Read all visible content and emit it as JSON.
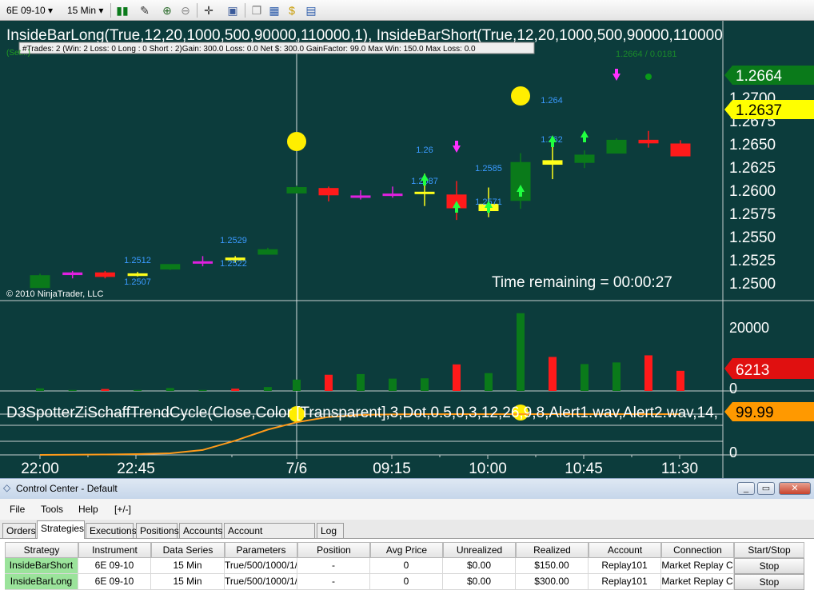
{
  "toolbar": {
    "instrument": "6E 09-10",
    "timeframe": "15 Min"
  },
  "chart": {
    "strategy_title": "InsideBarLong(True,12,20,1000,500,90000,110000,1), InsideBarShort(True,12,20,1000,500,90000,110000",
    "stats": "#Trades: 2 (Win: 2 Loss: 0 Long : 0 Short : 2)Gain: 300.0 Loss: 0.0 Net $: 300.0 GainFactor: 99.0 Max Win: 150.0 Max Loss: 0.0",
    "subtitle": "(Set...)",
    "copyright": "© 2010 NinjaTrader, LLC",
    "time_remaining": "Time remaining = 00:00:27",
    "crosshair_readout": "1.2664 / 0.0181",
    "price_badge_green": "1.2664",
    "price_badge_yellow": "1.2637",
    "volume_badge": "6213",
    "indicator_title": "D3SpotterZiSchaffTrendCycle(Close,Color [Transparent],3,Dot,0.5,0,3,12,26,9,8,Alert1.wav,Alert2.wav,14,",
    "indicator_badge": "99.99",
    "bar_labels": [
      "1.2512",
      "1.2507",
      "1.2529",
      "1.2522",
      "1.26",
      "1.2587",
      "1.2585",
      "1.2571",
      "1.264",
      "1.262"
    ],
    "colors": {
      "background": "#0c3c3c",
      "up": "#0a7a1a",
      "down": "#ff1a1a",
      "doji": "#ffff1a",
      "neutral": "#e020e0",
      "badge_green": "#0a7a1a",
      "badge_yellow": "#ffff00",
      "badge_red": "#e01010",
      "badge_orange": "#ff9900",
      "cycle_line": "#ff9a1a"
    }
  },
  "chart_data": {
    "type": "candlestick",
    "y_ticks": [
      "1.2700",
      "1.2675",
      "1.2650",
      "1.2625",
      "1.2600",
      "1.2575",
      "1.2550",
      "1.2525",
      "1.2500"
    ],
    "volume_ticks": [
      "20000",
      "0"
    ],
    "indicator_ticks": [
      "0"
    ],
    "x_ticks": [
      "22:00",
      "22:45",
      "7/6",
      "09:15",
      "10:00",
      "10:45",
      "11:30"
    ],
    "candles": [
      {
        "o": 1.2495,
        "h": 1.251,
        "l": 1.2495,
        "c": 1.2508,
        "color": "up"
      },
      {
        "o": 1.2511,
        "h": 1.2513,
        "l": 1.2505,
        "c": 1.2509,
        "color": "neutral"
      },
      {
        "o": 1.2511,
        "h": 1.2513,
        "l": 1.2505,
        "c": 1.2507,
        "color": "down"
      },
      {
        "o": 1.251,
        "h": 1.2512,
        "l": 1.2507,
        "c": 1.2508,
        "color": "doji"
      },
      {
        "o": 1.2515,
        "h": 1.252,
        "l": 1.2514,
        "c": 1.252,
        "color": "up"
      },
      {
        "o": 1.2523,
        "h": 1.2529,
        "l": 1.2518,
        "c": 1.2522,
        "color": "neutral"
      },
      {
        "o": 1.2525,
        "h": 1.2529,
        "l": 1.2522,
        "c": 1.2527,
        "color": "doji"
      },
      {
        "o": 1.2531,
        "h": 1.2538,
        "l": 1.2531,
        "c": 1.2536,
        "color": "up"
      },
      {
        "o": 1.2597,
        "h": 1.2605,
        "l": 1.2597,
        "c": 1.2603,
        "color": "up"
      },
      {
        "o": 1.2602,
        "h": 1.2604,
        "l": 1.2588,
        "c": 1.2595,
        "color": "down"
      },
      {
        "o": 1.2594,
        "h": 1.26,
        "l": 1.259,
        "c": 1.2594,
        "color": "neutral"
      },
      {
        "o": 1.2596,
        "h": 1.2604,
        "l": 1.2592,
        "c": 1.2596,
        "color": "neutral"
      },
      {
        "o": 1.2598,
        "h": 1.2618,
        "l": 1.2583,
        "c": 1.2597,
        "color": "doji"
      },
      {
        "o": 1.2595,
        "h": 1.261,
        "l": 1.2568,
        "c": 1.2581,
        "color": "down"
      },
      {
        "o": 1.2585,
        "h": 1.2603,
        "l": 1.2571,
        "c": 1.2578,
        "color": "doji"
      },
      {
        "o": 1.2589,
        "h": 1.264,
        "l": 1.258,
        "c": 1.263,
        "color": "up"
      },
      {
        "o": 1.2632,
        "h": 1.2653,
        "l": 1.2612,
        "c": 1.2628,
        "color": "doji"
      },
      {
        "o": 1.263,
        "h": 1.2643,
        "l": 1.2624,
        "c": 1.2638,
        "color": "up"
      },
      {
        "o": 1.264,
        "h": 1.2656,
        "l": 1.264,
        "c": 1.2654,
        "color": "up"
      },
      {
        "o": 1.2654,
        "h": 1.2664,
        "l": 1.2646,
        "c": 1.2651,
        "color": "down"
      },
      {
        "o": 1.265,
        "h": 1.2654,
        "l": 1.2637,
        "c": 1.2637,
        "color": "down"
      }
    ],
    "volumes": [
      {
        "v": 800,
        "color": "up"
      },
      {
        "v": 300,
        "color": "neutral"
      },
      {
        "v": 600,
        "color": "down"
      },
      {
        "v": 300,
        "color": "doji"
      },
      {
        "v": 900,
        "color": "up"
      },
      {
        "v": 300,
        "color": "neutral"
      },
      {
        "v": 700,
        "color": "down"
      },
      {
        "v": 1200,
        "color": "up"
      },
      {
        "v": 3500,
        "color": "up"
      },
      {
        "v": 5000,
        "color": "down"
      },
      {
        "v": 5200,
        "color": "up"
      },
      {
        "v": 3800,
        "color": "up"
      },
      {
        "v": 3900,
        "color": "up"
      },
      {
        "v": 8200,
        "color": "down"
      },
      {
        "v": 5500,
        "color": "up"
      },
      {
        "v": 24000,
        "color": "up"
      },
      {
        "v": 10500,
        "color": "down"
      },
      {
        "v": 8300,
        "color": "up"
      },
      {
        "v": 8800,
        "color": "up"
      },
      {
        "v": 11000,
        "color": "down"
      },
      {
        "v": 6213,
        "color": "down"
      }
    ],
    "cycle": [
      0,
      0.5,
      1,
      2,
      4,
      12,
      35,
      62,
      80,
      93,
      98,
      99.5,
      99.9,
      99.99,
      99.99,
      99.99,
      99.99,
      99.99,
      99.99,
      99.99,
      99.99
    ]
  },
  "control_center": {
    "title": "Control Center - Default",
    "menu": [
      "File",
      "Tools",
      "Help",
      "[+/-]"
    ],
    "tabs": [
      "Orders",
      "Strategies",
      "Executions",
      "Positions",
      "Accounts",
      "Account Performance",
      "Log"
    ],
    "active_tab": 1,
    "columns": [
      "Strategy",
      "Instrument",
      "Data Series",
      "Parameters",
      "Position",
      "Avg Price",
      "Unrealized",
      "Realized",
      "Account",
      "Connection",
      "Start/Stop"
    ],
    "rows": [
      [
        "InsideBarShort",
        "6E 09-10",
        "15 Min",
        "True/500/1000/1/",
        "-",
        "0",
        "$0.00",
        "$150.00",
        "Replay101",
        "Market Replay C",
        "Stop"
      ],
      [
        "InsideBarLong",
        "6E 09-10",
        "15 Min",
        "True/500/1000/1/",
        "-",
        "0",
        "$0.00",
        "$300.00",
        "Replay101",
        "Market Replay C",
        "Stop"
      ]
    ]
  }
}
